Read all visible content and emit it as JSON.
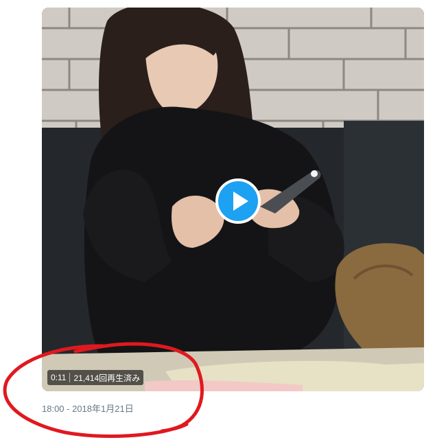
{
  "video": {
    "duration": "0:11",
    "views": "21,414回再生済み",
    "play_icon": "play-icon"
  },
  "tweet": {
    "timestamp": "18:00 - 2018年1月21日"
  },
  "colors": {
    "play_button": "#1da1f2",
    "timestamp_text": "#657786",
    "annotation": "#e0191f"
  }
}
